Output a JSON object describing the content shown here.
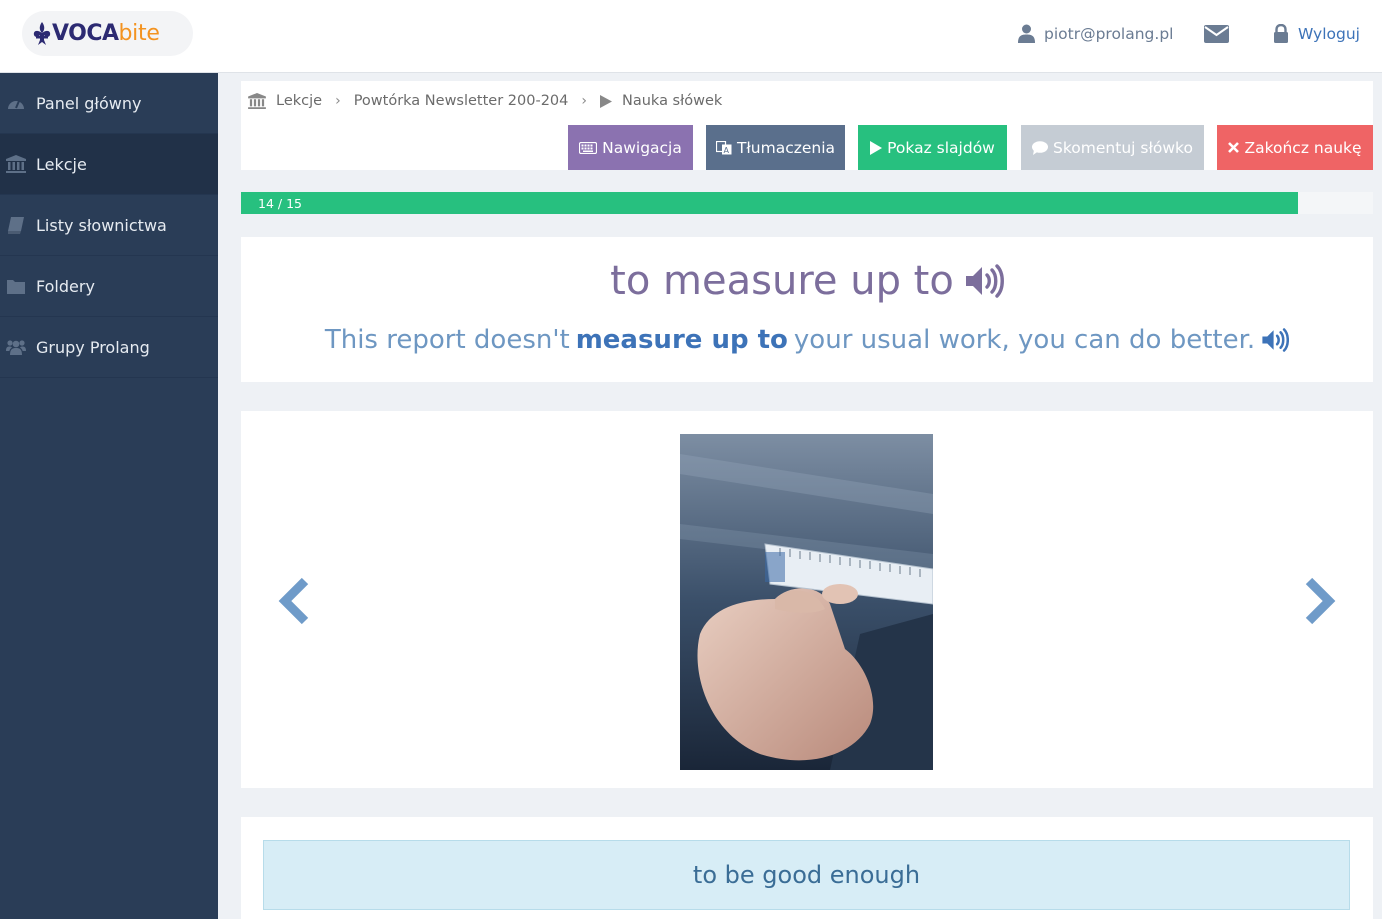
{
  "logo": {
    "part1": "VOCA",
    "part2": "bite"
  },
  "topbar": {
    "user": "piotr@prolang.pl",
    "logout": "Wyloguj"
  },
  "sidebar": {
    "items": [
      {
        "label": "Panel główny",
        "icon": "dashboard-icon"
      },
      {
        "label": "Lekcje",
        "icon": "bank-icon",
        "active": true
      },
      {
        "label": "Listy słownictwa",
        "icon": "book-icon"
      },
      {
        "label": "Foldery",
        "icon": "folder-icon"
      },
      {
        "label": "Grupy Prolang",
        "icon": "users-icon"
      }
    ]
  },
  "breadcrumb": {
    "items": [
      "Lekcje",
      "Powtórka Newsletter 200-204",
      "Nauka słówek"
    ]
  },
  "toolbar": {
    "nav": "Nawigacja",
    "translations": "Tłumaczenia",
    "slideshow": "Pokaz slajdów",
    "comment": "Skomentuj słówko",
    "end": "Zakończ naukę"
  },
  "progress": {
    "label": "14 / 15",
    "current": 14,
    "total": 15
  },
  "card": {
    "word": "to measure up to",
    "sentence_before": "This report doesn't",
    "sentence_bold": "measure up to",
    "sentence_after": "your usual work, you can do better.",
    "meaning": "to be good enough"
  },
  "colors": {
    "sidebar": "#2a3d57",
    "accent_green": "#27c07f",
    "accent_purple": "#8b72b0",
    "accent_red": "#ef6465",
    "link_blue": "#3d73b8"
  }
}
